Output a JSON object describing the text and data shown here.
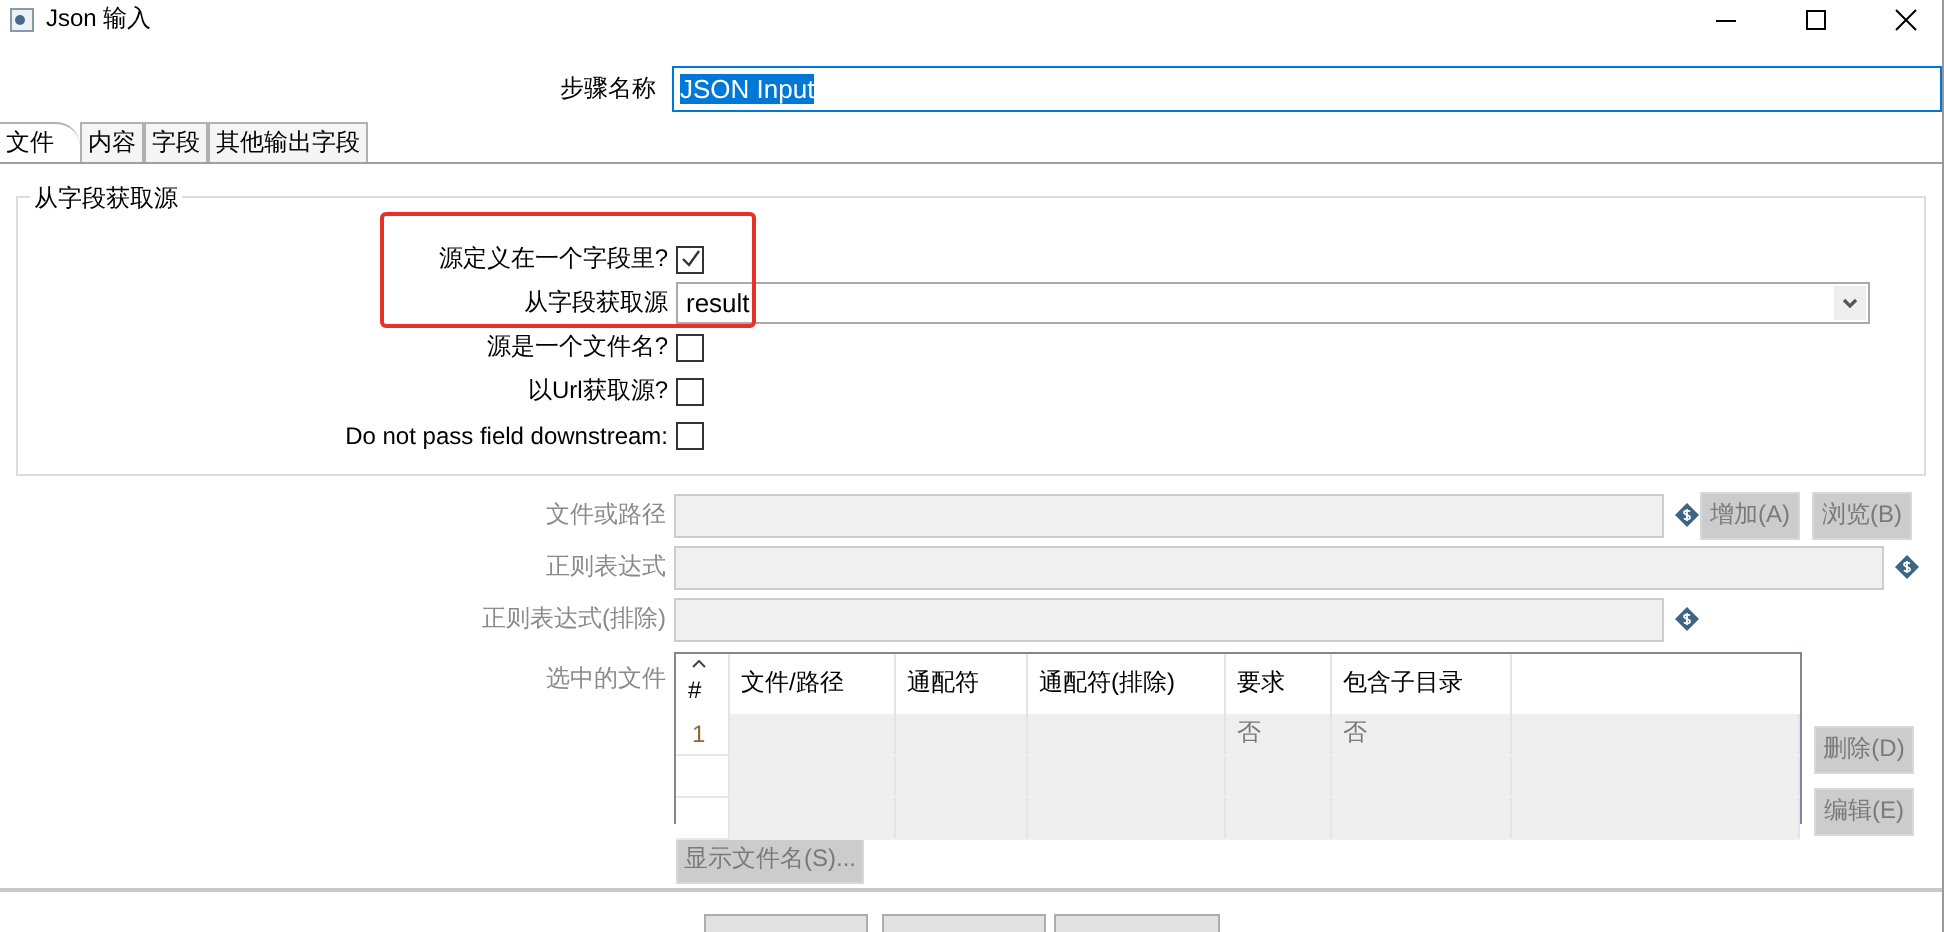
{
  "window": {
    "title": "Json 输入"
  },
  "step_name": {
    "label": "步骤名称",
    "value": "JSON Input",
    "selected": true
  },
  "tabs": [
    {
      "label": "文件",
      "selected": true
    },
    {
      "label": "内容",
      "selected": false
    },
    {
      "label": "字段",
      "selected": false
    },
    {
      "label": "其他输出字段",
      "selected": false
    }
  ],
  "source_group": {
    "title": "从字段获取源",
    "highlight_box": true,
    "rows": [
      {
        "kind": "checkbox",
        "label": "源定义在一个字段里?",
        "checked": true
      },
      {
        "kind": "select",
        "label": "从字段获取源",
        "value": "result"
      },
      {
        "kind": "checkbox",
        "label": "源是一个文件名?",
        "checked": false
      },
      {
        "kind": "checkbox",
        "label": "以Url获取源?",
        "checked": false
      },
      {
        "kind": "checkbox",
        "label": "Do not pass field downstream:",
        "checked": false
      }
    ]
  },
  "file_fields": [
    {
      "label": "文件或路径",
      "disabled": true,
      "wide": false,
      "buttons": [
        "增加(A)",
        "浏览(B)"
      ]
    },
    {
      "label": "正则表达式",
      "disabled": true,
      "wide": true
    },
    {
      "label": "正则表达式(排除)",
      "disabled": true,
      "wide": false
    }
  ],
  "selected_files": {
    "label": "选中的文件",
    "disabled": true,
    "columns": [
      "#",
      "文件/路径",
      "通配符",
      "通配符(排除)",
      "要求",
      "包含子目录"
    ],
    "rows": [
      [
        "1",
        "",
        "",
        "",
        "否",
        "否"
      ]
    ],
    "side_buttons": [
      "删除(D)",
      "编辑(E)"
    ],
    "show_button": "显示文件名(S)..."
  }
}
